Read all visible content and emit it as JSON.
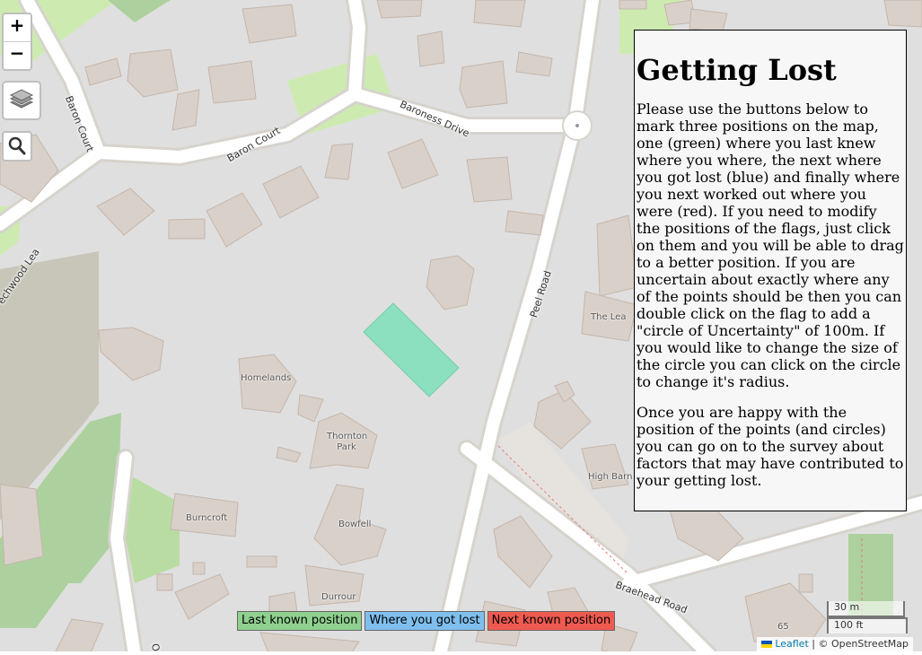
{
  "map": {
    "street_labels": {
      "baron_court_vertical": "Baron Court",
      "baron_court": "Baron Court",
      "baroness_drive": "Baroness Drive",
      "peel_road": "Peel Road",
      "braehead_road": "Braehead Road",
      "beechwood_lea": "echwood Lea",
      "os_partial": "Os"
    },
    "place_labels": {
      "homelands": "Homelands",
      "thornton_park": "Thornton Park",
      "burncroft": "Burncroft",
      "bowfell": "Bowfell",
      "durrour": "Durrour",
      "the_lea": "The Lea",
      "high_barn": "High Barn",
      "house_65": "65"
    },
    "highlight_color": "#88dfbe"
  },
  "controls": {
    "zoom_in": "+",
    "zoom_out": "−",
    "layers_icon": "layers-icon",
    "search_icon": "search-icon"
  },
  "panel": {
    "title": "Getting Lost",
    "paragraph1": "Please use the buttons below to mark three positions on the map, one (green) where you last knew where you where, the next where you got lost (blue) and finally where you next worked out where you were (red). If you need to modify the positions of the flags, just click on them and you will be able to drag to a better position. If you are uncertain about exactly where any of the points should be then you can double click on the flag to add a \"circle of Uncertainty\" of 100m. If you would like to change the size of the circle you can click on the circle to change it's radius.",
    "paragraph2": "Once you are happy with the position of the points (and circles) you can go on to the survey about factors that may have contributed to your getting lost."
  },
  "buttons": {
    "last_known": "Last known position",
    "got_lost": "Where you got lost",
    "next_known": "Next known position"
  },
  "scale": {
    "metric": "30 m",
    "imperial": "100 ft"
  },
  "attribution": {
    "leaflet": "Leaflet",
    "separator": " | © ",
    "osm": "OpenStreetMap"
  }
}
